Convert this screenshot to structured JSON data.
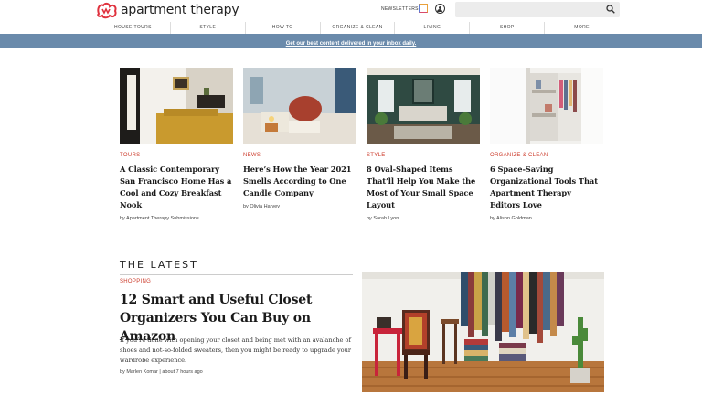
{
  "header": {
    "brand": "apartment therapy",
    "newsletters_label": "NEWSLETTERS"
  },
  "nav": {
    "items": [
      "HOUSE TOURS",
      "STYLE",
      "HOW TO",
      "ORGANIZE & CLEAN",
      "LIVING",
      "SHOP",
      "MORE"
    ]
  },
  "promo": {
    "text": "Get our best content delivered in your inbox daily."
  },
  "cards": [
    {
      "category": "TOURS",
      "title": "A Classic Contemporary San Francisco Home Has a Cool and Cozy Breakfast Nook",
      "byline": "by Apartment Therapy Submissions"
    },
    {
      "category": "NEWS",
      "title": "Here’s How the Year 2021 Smells According to One Candle Company",
      "byline": "by Olivia Harvey"
    },
    {
      "category": "STYLE",
      "title": "8 Oval-Shaped Items That’ll Help You Make the Most of Your Small Space Layout",
      "byline": "by Sarah Lyon"
    },
    {
      "category": "ORGANIZE & CLEAN",
      "title": "6 Space-Saving Organizational Tools That Apartment Therapy Editors Love",
      "byline": "by Alison Goldman"
    }
  ],
  "latest": {
    "heading": "THE LATEST",
    "category": "SHOPPING",
    "title": "12 Smart and Useful Closet Organizers You Can Buy on Amazon",
    "description": "If you’re done with opening your closet and being met with an avalanche of shoes and not-so-folded sweaters, then you might be ready to upgrade your wardrobe experience.",
    "meta": "by Marlen Komar | about 7 hours ago"
  },
  "colors": {
    "accent_red": "#cc3b2b",
    "promo_bar": "#6a8aab",
    "logo_red": "#e0323e"
  }
}
